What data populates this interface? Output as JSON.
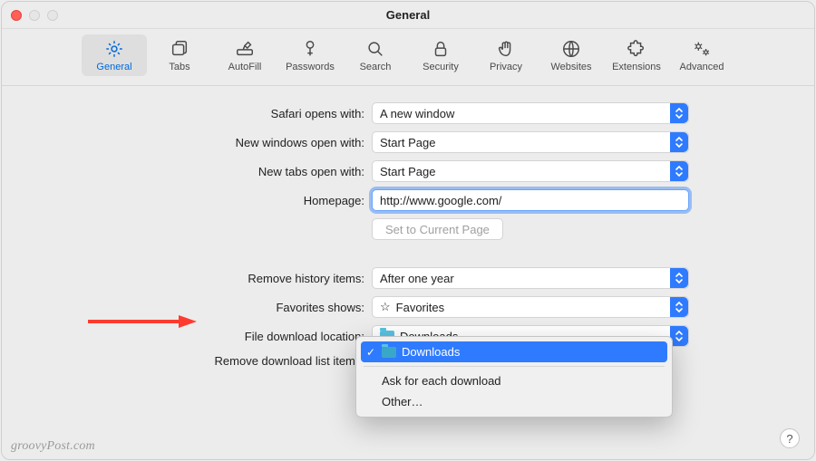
{
  "window": {
    "title": "General"
  },
  "toolbar": {
    "tabs": [
      {
        "id": "general",
        "label": "General",
        "icon": "gear-icon",
        "active": true
      },
      {
        "id": "tabs",
        "label": "Tabs",
        "icon": "tabs-icon",
        "active": false
      },
      {
        "id": "autofill",
        "label": "AutoFill",
        "icon": "pencil-icon",
        "active": false
      },
      {
        "id": "passwords",
        "label": "Passwords",
        "icon": "key-icon",
        "active": false
      },
      {
        "id": "search",
        "label": "Search",
        "icon": "search-icon",
        "active": false
      },
      {
        "id": "security",
        "label": "Security",
        "icon": "lock-icon",
        "active": false
      },
      {
        "id": "privacy",
        "label": "Privacy",
        "icon": "hand-icon",
        "active": false
      },
      {
        "id": "websites",
        "label": "Websites",
        "icon": "globe-icon",
        "active": false
      },
      {
        "id": "extensions",
        "label": "Extensions",
        "icon": "puzzle-icon",
        "active": false
      },
      {
        "id": "advanced",
        "label": "Advanced",
        "icon": "gears-icon",
        "active": false
      }
    ]
  },
  "form": {
    "opens_with": {
      "label": "Safari opens with:",
      "value": "A new window"
    },
    "new_windows": {
      "label": "New windows open with:",
      "value": "Start Page"
    },
    "new_tabs": {
      "label": "New tabs open with:",
      "value": "Start Page"
    },
    "homepage": {
      "label": "Homepage:",
      "value": "http://www.google.com/"
    },
    "set_current": {
      "label": "Set to Current Page"
    },
    "remove_history": {
      "label": "Remove history items:",
      "value": "After one year"
    },
    "favorites": {
      "label": "Favorites shows:",
      "value": "Favorites"
    },
    "download_loc": {
      "label": "File download location:",
      "value": "Downloads"
    },
    "remove_dl": {
      "label": "Remove download list items:"
    }
  },
  "dropdown": {
    "items": [
      {
        "label": "Downloads",
        "selected": true,
        "icon": "folder"
      },
      {
        "sep": true
      },
      {
        "label": "Ask for each download",
        "selected": false
      },
      {
        "label": "Other…",
        "selected": false
      }
    ]
  },
  "watermark": "groovyPost.com",
  "help_tooltip": "?"
}
